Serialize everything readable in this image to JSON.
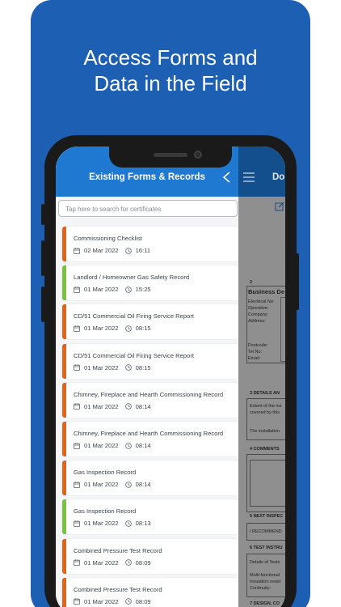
{
  "headline": {
    "line1": "Access Forms and",
    "line2": "Data in the Field"
  },
  "colors": {
    "brand_blue": "#1c5fb3",
    "header_blue": "#1f79d1",
    "stripe_orange": "#e0631e",
    "stripe_green": "#7bc043"
  },
  "app": {
    "title": "Existing Forms & Records",
    "back_icon": "chevron-left-icon",
    "search": {
      "placeholder": "Tap here to search for certificates",
      "value": ""
    },
    "records": [
      {
        "title": "Commissioning Checklist",
        "date": "02 Mar 2022",
        "time": "16:11",
        "status": "orange"
      },
      {
        "title": "Landlord / Homeowner Gas Safety Record",
        "date": "01 Mar 2022",
        "time": "15:25",
        "status": "green"
      },
      {
        "title": "CD/51 Commercial Oil Firing Service Report",
        "date": "01 Mar 2022",
        "time": "08:15",
        "status": "orange"
      },
      {
        "title": "CD/51 Commercial Oil Firing Service Report",
        "date": "01 Mar 2022",
        "time": "08:15",
        "status": "orange"
      },
      {
        "title": "Chimney, Fireplace and Hearth Commissioning Record",
        "date": "01 Mar 2022",
        "time": "08:14",
        "status": "orange"
      },
      {
        "title": "Chimney, Fireplace and Hearth Commissioning Record",
        "date": "01 Mar 2022",
        "time": "08:14",
        "status": "orange"
      },
      {
        "title": "Gas Inspection Record",
        "date": "01 Mar 2022",
        "time": "08:14",
        "status": "orange"
      },
      {
        "title": "Gas Inspection Record",
        "date": "01 Mar 2022",
        "time": "08:13",
        "status": "green"
      },
      {
        "title": "Combined Pressure Test Record",
        "date": "01 Mar 2022",
        "time": "08:09",
        "status": "orange"
      },
      {
        "title": "Combined Pressure Test Record",
        "date": "01 Mar 2022",
        "time": "08:09",
        "status": "orange"
      }
    ]
  },
  "document": {
    "header_title": "Do",
    "menu_icon": "hamburger-menu-icon",
    "edit_icon": "edit-icon",
    "section2_num": "2",
    "section2_title": "Business De",
    "fields": [
      "Electrical No:",
      "Operative:",
      "Company:",
      "Address:"
    ],
    "fields2": [
      "Postcode:",
      "Tel No:",
      "Email:"
    ],
    "s3": "3  DETAILS AN",
    "s3_l1": "Extent of the ins",
    "s3_l2": "covered by this",
    "s3_l3": "The installation",
    "s4": "4  COMMENTS",
    "s5": "5  NEXT INSPEC",
    "s5_l1": "I RECOMMEND",
    "s6": "6  TEST INSTRU",
    "s6_l1": "Details of Tests",
    "s6_l2": "Multi-functional",
    "s6_l3": "Insulation resist",
    "s6_l4": "Continuity:",
    "s7": "7  DESIGN, CO"
  }
}
